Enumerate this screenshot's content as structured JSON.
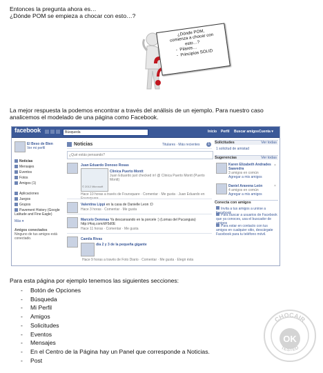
{
  "intro": {
    "line1": "Entonces la pregunta ahora es…",
    "line2": "¿Dónde POM se empieza a chocar con esto…?"
  },
  "sign": {
    "line1": "¿Dónde POM,",
    "line2": "comienza a chocar con",
    "line3": "esto…?",
    "item1": "Pilares…",
    "item2": "Principios SOLID",
    "dash": "-"
  },
  "paragraph": {
    "line1": "La mejor respuesta la podemos encontrar a través del análisis de un ejemplo. Para nuestro caso",
    "line2": "analicemos el modelado de una página como Facebook."
  },
  "facebook": {
    "logo": "facebook",
    "search_value": "Búsqueda",
    "nav": [
      "Inicio",
      "Perfil",
      "Buscar amigos",
      "Cuenta ▾"
    ],
    "profile_name": "El Beso de Bien",
    "profile_link": "Ver mi perfil",
    "left_menu": [
      "Noticias",
      "Mensajes",
      "Eventos",
      "Fotos",
      "Amigos (1)"
    ],
    "apps": [
      "Aplicaciones",
      "Juegos",
      "Grupos",
      "Pavement History (Google Latitude and Fine Eagle)",
      "Más ▾"
    ],
    "online_title": "Amigos conectados",
    "online_text": "Ninguno de tus amigos está conectado.",
    "feed_title": "Noticias",
    "feed_tabs": "Titulares · Más recientes",
    "feed_badge": "1",
    "status_placeholder": "¿Qué estás pensando?",
    "posts": [
      {
        "author": "Juan Eduardo Donoso Rosas",
        "place": "Clinica Puerto Montt",
        "sub": "Juan Eduardo just checked in! @ Clinica Puerto Montt (Puerto Montt)",
        "map": "© 2012 Microsoft",
        "meta": "Hace 10 horas a través de Foursquare · Comentar · Me gusta · Juan Eduardo en Foursquare"
      },
      {
        "author": "Valentina Lippi",
        "text": "en la casa de Danielle Leon :D",
        "meta": "Hace 3 horas · Comentar · Me gusta"
      },
      {
        "author": "Marcelo Demmas",
        "text": "Ya descansando en la porcele :) (Lomas del Pucanguia) http://4sq.com/dF5d0E",
        "meta": "Hace 11 horas · Comentar · Me gusta"
      },
      {
        "author": "Camila Rivas",
        "text": "día 2 y 3 de la pequeña gigante",
        "sub": "Hace 9 horas a través de Foto Diario · Comentar · Me gusta · Elegir ésta",
        "meta": ""
      }
    ],
    "requests_title": "Solicitudes",
    "requests_link": "Ver todas",
    "requests_item": "1 solicitud de amistad",
    "suggest_title": "Sugerencias",
    "suggest_link": "Ver todas",
    "suggestions": [
      {
        "name": "Karen Elizabeth Andrades Saavedra",
        "common": "3 amigos en común",
        "action": "Agregar a mis amigos"
      },
      {
        "name": "Daniel Aravena León",
        "common": "4 amigos en común",
        "action": "Agregar a mis amigos"
      }
    ],
    "connect_title": "Conecta con amigos",
    "connect_items": [
      "Invita a tus amigos a unirse a Facebook",
      "Para buscar a usuarios de Facebook que ya conoces, usa el buscador de amigos",
      "Para estar en contacto con tus amigos en cualquier sitio, descárgate Facebook para tu teléfono móvil."
    ]
  },
  "sections_intro": "Para esta página por ejemplo tenemos las siguientes secciones:",
  "sections": [
    "Botón de Opciones",
    "Búsqueda",
    "Mi Perfil",
    "Amigos",
    "Solicitudes",
    "Eventos",
    "Mensajes",
    "En el Centro de la Página hay un Panel que corresponde a Noticias.",
    "Post"
  ],
  "stamp": {
    "top": "CHOCAIR",
    "center": "OK",
    "bottom": "TESTED"
  }
}
